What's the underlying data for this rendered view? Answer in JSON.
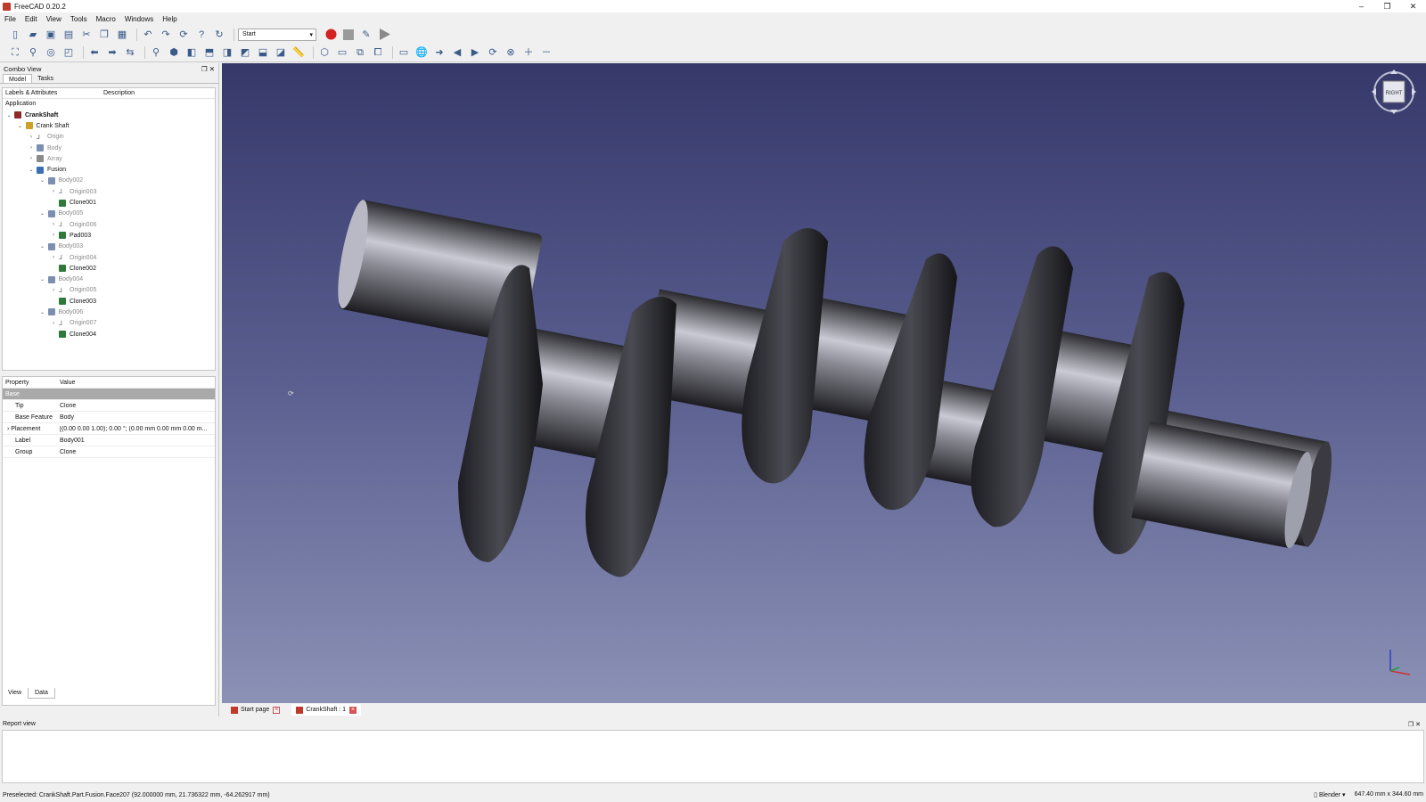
{
  "titlebar": {
    "title": "FreeCAD 0.20.2",
    "min": "–",
    "max": "❐",
    "close": "✕"
  },
  "menu": [
    "File",
    "Edit",
    "View",
    "Tools",
    "Macro",
    "Windows",
    "Help"
  ],
  "toolbar": {
    "workbench": "Start"
  },
  "combo": {
    "title": "Combo View",
    "tabs": [
      "Model",
      "Tasks"
    ],
    "tree_columns": [
      "Labels & Attributes",
      "Description"
    ],
    "application_label": "Application",
    "tree": [
      {
        "label": "CrankShaft",
        "depth": 0,
        "arrow": "open",
        "icon": "doc",
        "bold": true,
        "dim": false
      },
      {
        "label": "Crank Shaft",
        "depth": 1,
        "arrow": "open",
        "icon": "part",
        "bold": false,
        "dim": false
      },
      {
        "label": "Origin",
        "depth": 2,
        "arrow": "closed",
        "icon": "origin",
        "bold": false,
        "dim": true
      },
      {
        "label": "Body",
        "depth": 2,
        "arrow": "closed",
        "icon": "body",
        "bold": false,
        "dim": true
      },
      {
        "label": "Array",
        "depth": 2,
        "arrow": "closed",
        "icon": "array",
        "bold": false,
        "dim": true
      },
      {
        "label": "Fusion",
        "depth": 2,
        "arrow": "open",
        "icon": "fusion",
        "bold": false,
        "dim": false
      },
      {
        "label": "Body002",
        "depth": 3,
        "arrow": "open",
        "icon": "body",
        "bold": false,
        "dim": true
      },
      {
        "label": "Origin003",
        "depth": 4,
        "arrow": "closed",
        "icon": "origin",
        "bold": false,
        "dim": true
      },
      {
        "label": "Clone001",
        "depth": 4,
        "arrow": "none",
        "icon": "clone",
        "bold": false,
        "dim": false
      },
      {
        "label": "Body005",
        "depth": 3,
        "arrow": "open",
        "icon": "body",
        "bold": false,
        "dim": true
      },
      {
        "label": "Origin006",
        "depth": 4,
        "arrow": "closed",
        "icon": "origin",
        "bold": false,
        "dim": true
      },
      {
        "label": "Pad003",
        "depth": 4,
        "arrow": "closed",
        "icon": "clone",
        "bold": false,
        "dim": false
      },
      {
        "label": "Body003",
        "depth": 3,
        "arrow": "open",
        "icon": "body",
        "bold": false,
        "dim": true
      },
      {
        "label": "Origin004",
        "depth": 4,
        "arrow": "closed",
        "icon": "origin",
        "bold": false,
        "dim": true
      },
      {
        "label": "Clone002",
        "depth": 4,
        "arrow": "none",
        "icon": "clone",
        "bold": false,
        "dim": false
      },
      {
        "label": "Body004",
        "depth": 3,
        "arrow": "open",
        "icon": "body",
        "bold": false,
        "dim": true
      },
      {
        "label": "Origin005",
        "depth": 4,
        "arrow": "closed",
        "icon": "origin",
        "bold": false,
        "dim": true
      },
      {
        "label": "Clone003",
        "depth": 4,
        "arrow": "none",
        "icon": "clone",
        "bold": false,
        "dim": false
      },
      {
        "label": "Body006",
        "depth": 3,
        "arrow": "open",
        "icon": "body",
        "bold": false,
        "dim": true
      },
      {
        "label": "Origin007",
        "depth": 4,
        "arrow": "closed",
        "icon": "origin",
        "bold": false,
        "dim": true
      },
      {
        "label": "Clone004",
        "depth": 4,
        "arrow": "none",
        "icon": "clone",
        "bold": false,
        "dim": false
      }
    ],
    "property_columns": [
      "Property",
      "Value"
    ],
    "property_group": "Base",
    "properties": [
      {
        "key": "Tip",
        "value": "Clone",
        "expandable": false
      },
      {
        "key": "Base Feature",
        "value": "Body",
        "expandable": false
      },
      {
        "key": "Placement",
        "value": "[(0.00 0.00 1.00); 0.00 °; (0.00 mm  0.00 mm  0.00 m...",
        "expandable": true
      },
      {
        "key": "Label",
        "value": "Body001",
        "expandable": false
      },
      {
        "key": "Group",
        "value": "Clone",
        "expandable": false
      }
    ],
    "bottom_tabs": [
      "View",
      "Data"
    ]
  },
  "doc_tabs": [
    "Start page",
    "CrankShaft : 1"
  ],
  "report": {
    "title": "Report view"
  },
  "status": {
    "message": "Preselected: CrankShaft.Part.Fusion.Face207 (92.000000 mm, 21.736322 mm, -64.262917 mm)",
    "nav_style": "Blender",
    "dimensions": "647.40 mm x 344.60 mm"
  },
  "navcube": {
    "face_label": "RIGHT"
  },
  "colors": {
    "viewport_top": "#36386a",
    "viewport_bottom": "#8c91b6",
    "record": "#d32020"
  }
}
